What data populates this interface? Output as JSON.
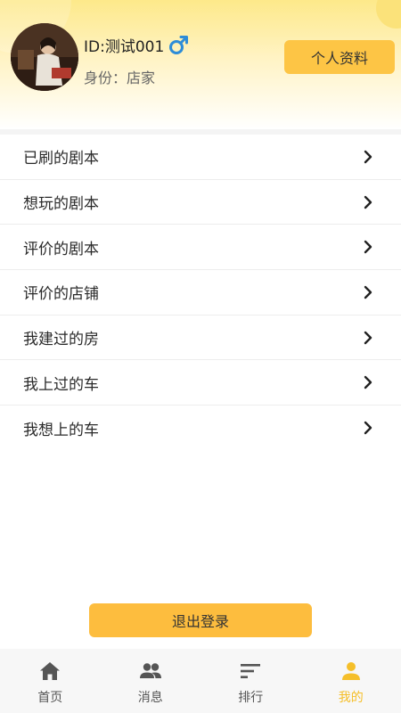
{
  "profile": {
    "user_id": "ID:测试001",
    "identity": "身份：店家",
    "edit_button": "个人资料",
    "gender_icon": "male-icon",
    "accent": "#fdc545"
  },
  "menu": {
    "items": [
      {
        "label": "已刷的剧本",
        "icon": "chevron-right-icon"
      },
      {
        "label": "想玩的剧本",
        "icon": "chevron-right-icon"
      },
      {
        "label": "评价的剧本",
        "icon": "chevron-right-icon"
      },
      {
        "label": "评价的店铺",
        "icon": "chevron-right-icon"
      },
      {
        "label": "我建过的房",
        "icon": "chevron-right-icon"
      },
      {
        "label": "我上过的车",
        "icon": "chevron-right-icon"
      },
      {
        "label": "我想上的车",
        "icon": "chevron-right-icon"
      }
    ]
  },
  "logout": {
    "label": "退出登录"
  },
  "tabbar": {
    "tabs": [
      {
        "label": "首页",
        "icon": "home-icon",
        "active": false
      },
      {
        "label": "消息",
        "icon": "people-icon",
        "active": false
      },
      {
        "label": "排行",
        "icon": "sort-icon",
        "active": false
      },
      {
        "label": "我的",
        "icon": "person-icon",
        "active": true
      }
    ],
    "active_color": "#f5bf2a",
    "inactive_color": "#555555"
  }
}
